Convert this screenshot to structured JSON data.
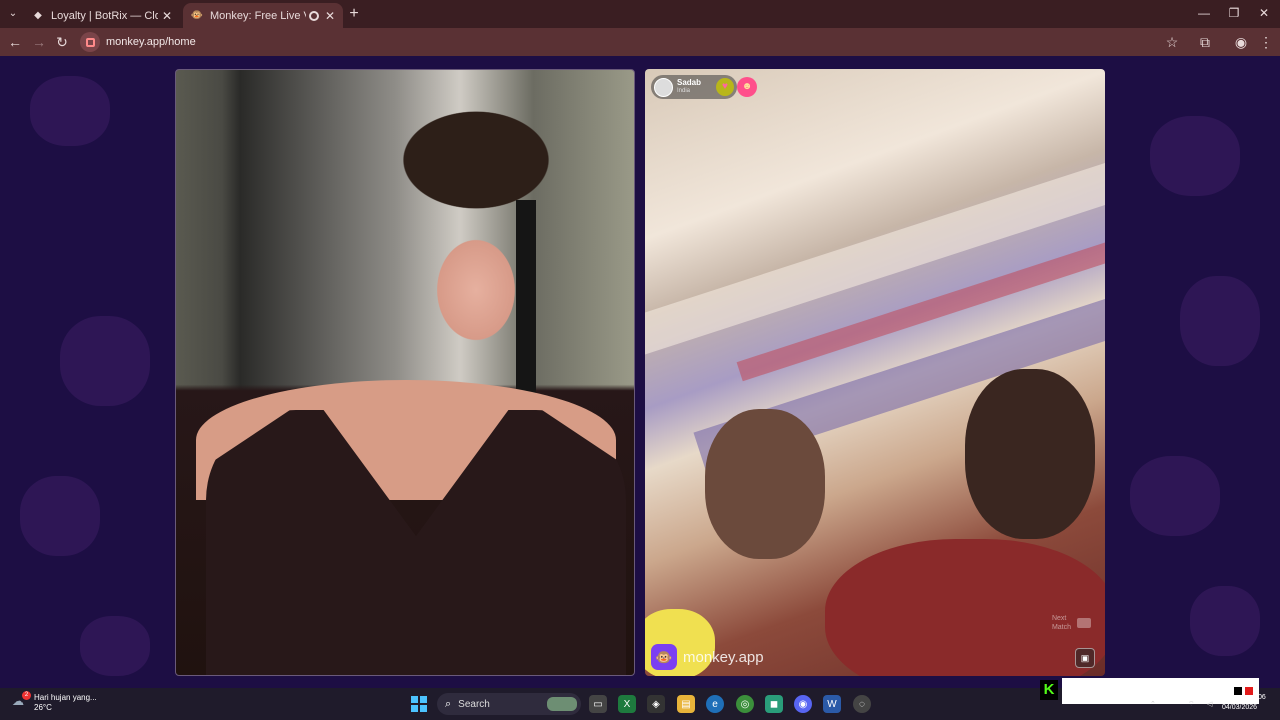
{
  "browser": {
    "tabs": [
      {
        "title": "Loyalty | BotRix — Cloud Stream",
        "active": false
      },
      {
        "title": "Monkey: Free Live Video Ch",
        "active": true
      }
    ],
    "url": "monkey.app/home"
  },
  "remote_user": {
    "name": "Sadab",
    "country": "India"
  },
  "video": {
    "brand": "monkey.app",
    "next_match_line1": "Next",
    "next_match_line2": "Match"
  },
  "taskbar": {
    "weather_text": "Hari hujan yang...",
    "temperature": "26°C",
    "weather_badge": "2",
    "search_label": "Search",
    "date": "04/03/2026",
    "time_fragment": "06"
  },
  "colors": {
    "page_bg": "#1d0e44",
    "tab_bar": "#3a1e22",
    "toolbar": "#5a3134",
    "kick_green": "#53fc18"
  }
}
